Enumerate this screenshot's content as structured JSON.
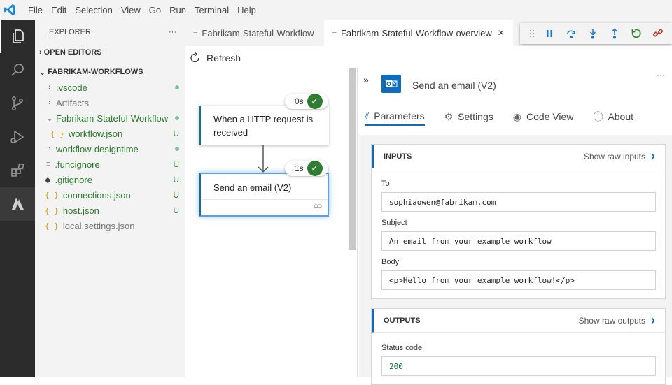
{
  "menu": [
    "File",
    "Edit",
    "Selection",
    "View",
    "Go",
    "Run",
    "Terminal",
    "Help"
  ],
  "explorer": {
    "title": "EXPLORER",
    "more": "···",
    "open_editors": "OPEN EDITORS",
    "workspace": "FABRIKAM-WORKFLOWS",
    "files": [
      {
        "name": ".vscode",
        "status": "dot"
      },
      {
        "name": "Artifacts",
        "status": ""
      },
      {
        "name": "Fabrikam-Stateful-Workflow",
        "status": "dot"
      },
      {
        "name": "workflow.json",
        "status": "U"
      },
      {
        "name": "workflow-designtime",
        "status": "dot"
      },
      {
        "name": ".funcignore",
        "status": "U"
      },
      {
        "name": ".gitignore",
        "status": "U"
      },
      {
        "name": "connections.json",
        "status": "U"
      },
      {
        "name": "host.json",
        "status": "U"
      },
      {
        "name": "local.settings.json",
        "status": ""
      }
    ]
  },
  "tabs": [
    {
      "label": "Fabrikam-Stateful-Workflow",
      "active": false
    },
    {
      "label": "Fabrikam-Stateful-Workflow-overview",
      "active": true,
      "close": "✕"
    }
  ],
  "designer": {
    "refresh": "Refresh",
    "trigger": {
      "title": "When a HTTP request is received",
      "duration": "0s"
    },
    "action": {
      "title": "Send an email (V2)",
      "duration": "1s"
    }
  },
  "panel": {
    "collapse": "»",
    "more": "···",
    "title": "Send an email (V2)",
    "tabs": [
      "Parameters",
      "Settings",
      "Code View",
      "About"
    ],
    "inputs": {
      "header": "INPUTS",
      "raw": "Show raw inputs",
      "fields": [
        {
          "label": "To",
          "value": "sophiaowen@fabrikam.com"
        },
        {
          "label": "Subject",
          "value": "An email from your example workflow"
        },
        {
          "label": "Body",
          "value": "<p>Hello from your example workflow!</p>"
        }
      ]
    },
    "outputs": {
      "header": "OUTPUTS",
      "raw": "Show raw outputs",
      "fields": [
        {
          "label": "Status code",
          "value": "200"
        }
      ]
    }
  },
  "colors": {
    "accent": "#0f6cbd",
    "success": "#2e7d32",
    "activitybar": "#2c2c2c"
  }
}
